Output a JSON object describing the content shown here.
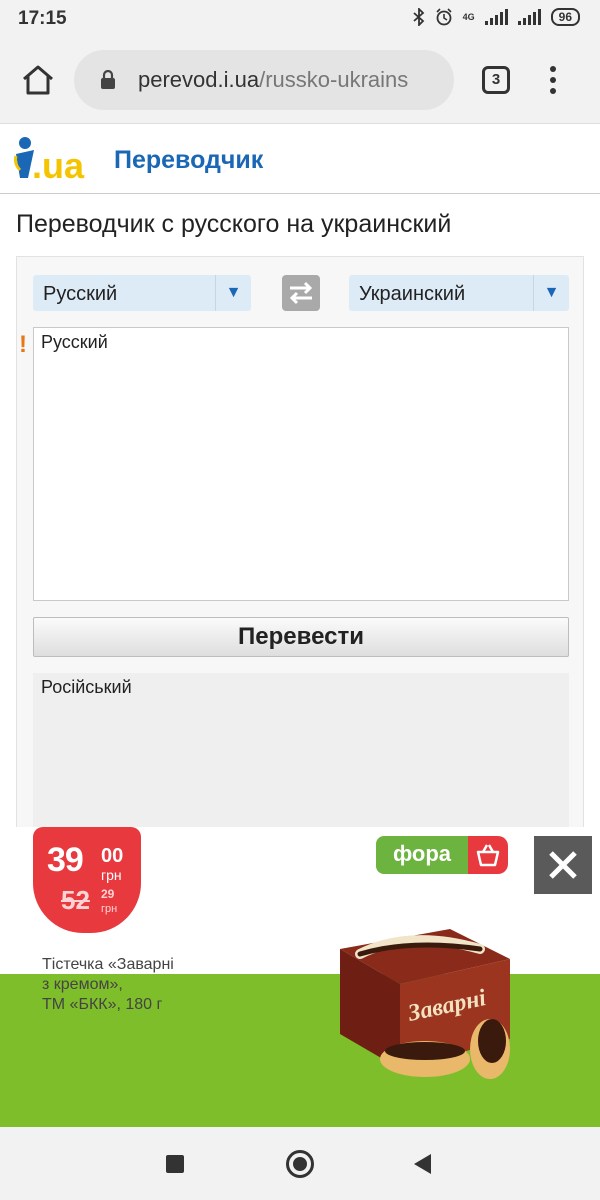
{
  "status": {
    "time": "17:15",
    "network": "4G",
    "battery": "96"
  },
  "browser": {
    "url_host": "perevod.i.ua",
    "url_path": "/russko-ukrains",
    "tab_count": "3"
  },
  "site": {
    "logo_text": ".ua",
    "title": "Переводчик"
  },
  "page": {
    "heading": "Переводчик с русского на украинский"
  },
  "translator": {
    "source_lang": "Русский",
    "target_lang": "Украинский",
    "source_text": "Русский",
    "translate_label": "Перевести",
    "result_text": "Російський",
    "warning_mark": "!"
  },
  "ad": {
    "price_now": "39",
    "price_now_kop": "00",
    "currency": "грн",
    "price_old": "52",
    "price_old_kop": "29",
    "currency_small": "грн",
    "product_line1": "Тістечка «Заварні",
    "product_line2": "з кремом»,",
    "product_line3": "ТМ «БКК», 180 г",
    "brand": "фора",
    "box_text": "Заварні",
    "colors": {
      "price_red": "#e8393f",
      "brand_green": "#6cb33f",
      "band_green": "#7fbe2b"
    }
  },
  "colors": {
    "accent_blue": "#1a67b5",
    "warning_orange": "#e77817"
  }
}
